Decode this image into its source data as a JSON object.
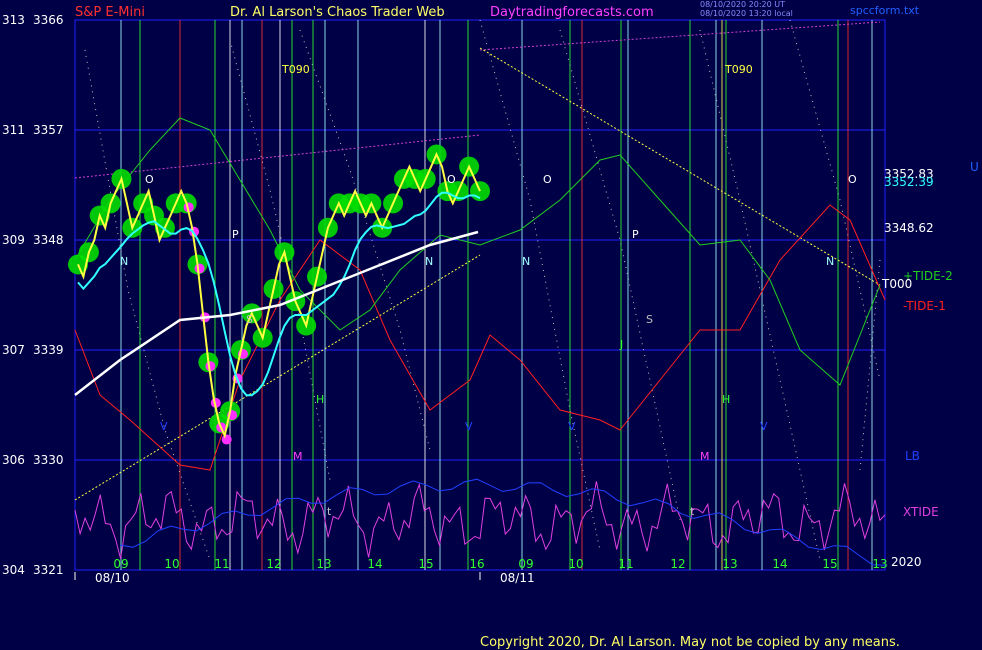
{
  "header": {
    "instrument": "S&P E-Mini",
    "author": "Dr. Al Larson's Chaos Trader Web",
    "site": "Daytradingforecasts.com",
    "stamp_line1": "08/10/2020 20:20 UT",
    "stamp_line2": "08/10/2020 13:20 local",
    "file": "spccform.txt",
    "corner_mark": "U"
  },
  "footer": {
    "copyright": "Copyright 2020, Dr. Al Larson. May not be copied by any means."
  },
  "colors": {
    "background": "#000046",
    "grid": "#2020ff",
    "price_yellow": "#ffff40",
    "pivot_green": "#00dd00",
    "cyan_ma": "#30ffff",
    "white_ma": "#ffffff",
    "tide1": "#ff2020",
    "tide2": "#20d020",
    "xtide": "#e040e0",
    "lb": "#2040ff",
    "channel_magenta": "#d040d0"
  },
  "chart_data": {
    "type": "line",
    "title": "S&P E-Mini",
    "y_left_labels": [
      {
        "a": "313",
        "b": "3366",
        "value": 3366
      },
      {
        "a": "311",
        "b": "3357",
        "value": 3357
      },
      {
        "a": "309",
        "b": "3348",
        "value": 3348
      },
      {
        "a": "307",
        "b": "3339",
        "value": 3339
      },
      {
        "a": "306",
        "b": "3330",
        "value": 3330
      },
      {
        "a": "304",
        "b": "3321",
        "value": 3321
      }
    ],
    "ylim": [
      3321,
      3366
    ],
    "x_hours": [
      "09",
      "10",
      "11",
      "12",
      "13",
      "14",
      "15",
      "16",
      "09",
      "10",
      "11",
      "12",
      "13",
      "14",
      "15",
      "13"
    ],
    "x_dates": [
      "08/10",
      "08/11"
    ],
    "year": "2020",
    "right_levels": [
      {
        "label": "3352.83",
        "value": 3352.83,
        "color": "#ffffff"
      },
      {
        "label": "3352.39",
        "value": 3352.39,
        "color": "#30ffff"
      },
      {
        "label": "3348.62",
        "value": 3348.62,
        "color": "#ffffff"
      }
    ],
    "right_series_labels": [
      {
        "label": "+TIDE-2",
        "color": "#20d020"
      },
      {
        "label": "T000",
        "color": "#ffffff"
      },
      {
        "label": "-TIDE-1",
        "color": "#ff2020"
      },
      {
        "label": "LB",
        "color": "#2040ff"
      },
      {
        "label": "XTIDE",
        "color": "#e040e0"
      }
    ],
    "vline_markers": [
      "T090",
      "T090",
      "O",
      "O",
      "O",
      "P",
      "P",
      "N",
      "N",
      "N",
      "N",
      "S",
      "S",
      "J",
      "H",
      "H",
      "M",
      "M",
      "t",
      "t",
      "t",
      "V",
      "V",
      "V",
      "V"
    ],
    "price_history": [
      3346,
      3345,
      3347,
      3348,
      3350,
      3349,
      3351,
      3352,
      3353,
      3351,
      3349,
      3350,
      3351,
      3352,
      3350,
      3348,
      3349,
      3350,
      3351,
      3352,
      3351,
      3349,
      3346,
      3342,
      3338,
      3335,
      3333,
      3332,
      3334,
      3337,
      3339,
      3341,
      3342,
      3341,
      3340,
      3342,
      3344,
      3346,
      3347,
      3345,
      3343,
      3342,
      3341,
      3343,
      3345,
      3347,
      3349,
      3350,
      3351,
      3350,
      3351,
      3352,
      3351,
      3350,
      3351,
      3350,
      3349,
      3350,
      3351,
      3352,
      3353,
      3354,
      3353,
      3352,
      3353,
      3354,
      3355,
      3354,
      3352,
      3351,
      3352,
      3353,
      3354,
      3353,
      3352
    ],
    "series": [
      {
        "name": "XTIDE"
      },
      {
        "name": "LB"
      },
      {
        "name": "-TIDE-1"
      },
      {
        "name": "+TIDE-2"
      },
      {
        "name": "T000"
      }
    ]
  }
}
